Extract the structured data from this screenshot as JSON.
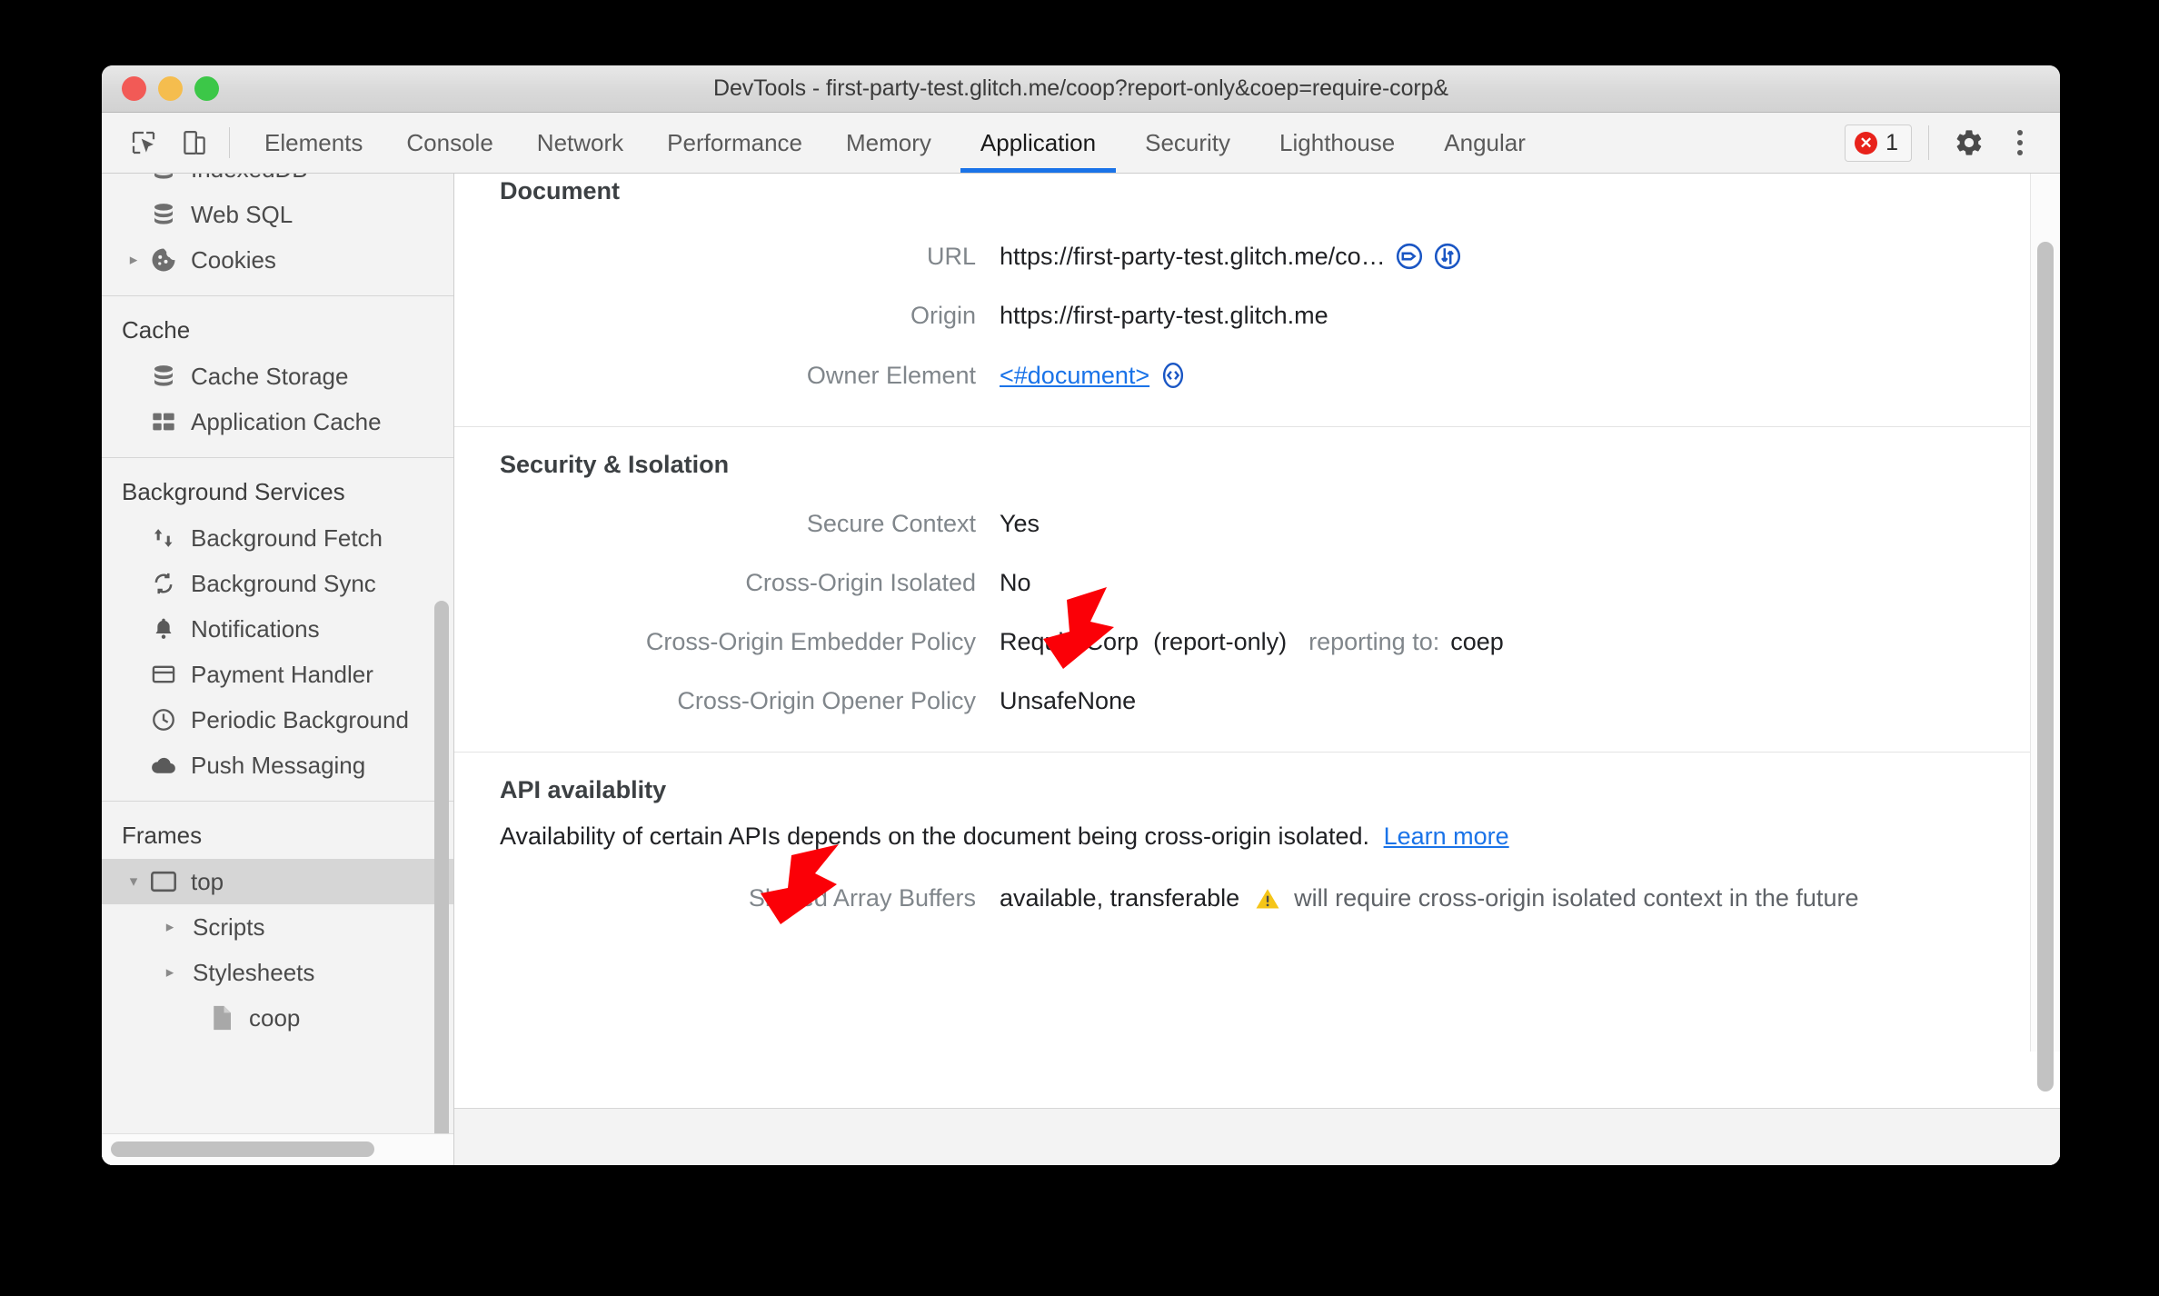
{
  "window": {
    "title": "DevTools - first-party-test.glitch.me/coop?report-only&coep=require-corp&"
  },
  "toolbar": {
    "inspect_icon": "inspect-element-icon",
    "device_icon": "device-toolbar-icon",
    "tabs": [
      {
        "label": "Elements",
        "active": false
      },
      {
        "label": "Console",
        "active": false
      },
      {
        "label": "Network",
        "active": false
      },
      {
        "label": "Performance",
        "active": false
      },
      {
        "label": "Memory",
        "active": false
      },
      {
        "label": "Application",
        "active": true
      },
      {
        "label": "Security",
        "active": false
      },
      {
        "label": "Lighthouse",
        "active": false
      },
      {
        "label": "Angular",
        "active": false
      }
    ],
    "error_count": "1",
    "settings_icon": "gear-icon",
    "more_icon": "more-vertical-icon",
    "active_tab_color": "#1a73e8",
    "error_color": "#e8221b"
  },
  "sidebar": {
    "groups": [
      {
        "title": "",
        "items": [
          {
            "label": "IndexedDB",
            "icon": "database-icon",
            "disclosure": "",
            "selected": false,
            "clipped": true
          },
          {
            "label": "Web SQL",
            "icon": "database-icon",
            "disclosure": "",
            "selected": false
          },
          {
            "label": "Cookies",
            "icon": "cookie-icon",
            "disclosure": "▸",
            "selected": false
          }
        ]
      },
      {
        "title": "Cache",
        "items": [
          {
            "label": "Cache Storage",
            "icon": "database-icon",
            "disclosure": "",
            "selected": false
          },
          {
            "label": "Application Cache",
            "icon": "grid-icon",
            "disclosure": "",
            "selected": false
          }
        ]
      },
      {
        "title": "Background Services",
        "items": [
          {
            "label": "Background Fetch",
            "icon": "up-down-arrows-icon",
            "disclosure": "",
            "selected": false
          },
          {
            "label": "Background Sync",
            "icon": "sync-icon",
            "disclosure": "",
            "selected": false
          },
          {
            "label": "Notifications",
            "icon": "bell-icon",
            "disclosure": "",
            "selected": false
          },
          {
            "label": "Payment Handler",
            "icon": "credit-card-icon",
            "disclosure": "",
            "selected": false
          },
          {
            "label": "Periodic Background",
            "icon": "clock-icon",
            "disclosure": "",
            "selected": false
          },
          {
            "label": "Push Messaging",
            "icon": "cloud-icon",
            "disclosure": "",
            "selected": false
          }
        ]
      },
      {
        "title": "Frames",
        "items": [
          {
            "label": "top",
            "icon": "frame-icon",
            "disclosure": "▾",
            "selected": true
          },
          {
            "label": "Scripts",
            "icon": "",
            "disclosure": "▸",
            "selected": false,
            "indent": 2
          },
          {
            "label": "Stylesheets",
            "icon": "",
            "disclosure": "▸",
            "selected": false,
            "indent": 2
          },
          {
            "label": "coop",
            "icon": "document-icon",
            "disclosure": "",
            "selected": false,
            "indent": 3
          }
        ]
      }
    ]
  },
  "main": {
    "document_section": {
      "heading": "Document",
      "rows": [
        {
          "key": "URL",
          "value": "https://first-party-test.glitch.me/co…",
          "icons": [
            "tag-circle-icon",
            "updown-circle-icon"
          ]
        },
        {
          "key": "Origin",
          "value": "https://first-party-test.glitch.me",
          "icons": []
        },
        {
          "key": "Owner Element",
          "value": "<#document>",
          "link": true,
          "icons": [
            "code-circle-icon"
          ]
        }
      ]
    },
    "security_section": {
      "heading": "Security & Isolation",
      "rows": [
        {
          "key": "Secure Context",
          "value": "Yes",
          "extra": "",
          "extra2": ""
        },
        {
          "key": "Cross-Origin Isolated",
          "value": "No",
          "extra": "",
          "extra2": ""
        },
        {
          "key": "Cross-Origin Embedder Policy",
          "value": "RequireCorp",
          "extra": "(report-only)",
          "extra2": "reporting to:",
          "extra3": "coep"
        },
        {
          "key": "Cross-Origin Opener Policy",
          "value": "UnsafeNone",
          "extra": "",
          "extra2": ""
        }
      ]
    },
    "api_section": {
      "heading": "API availablity",
      "description": "Availability of certain APIs depends on the document being cross-origin isolated.",
      "learn_more": "Learn more",
      "rows": [
        {
          "key": "Shared Array Buffers",
          "value": "available, transferable",
          "warning_icon": "warning-triangle-icon",
          "note": "will require cross-origin isolated context in the future"
        }
      ]
    }
  },
  "annotations": {
    "arrow_color": "#fb0007",
    "arrows": [
      {
        "name": "arrow-cross-origin-isolated",
        "points_to": "No"
      },
      {
        "name": "arrow-api-availablity",
        "points_to": "API availablity"
      }
    ]
  }
}
